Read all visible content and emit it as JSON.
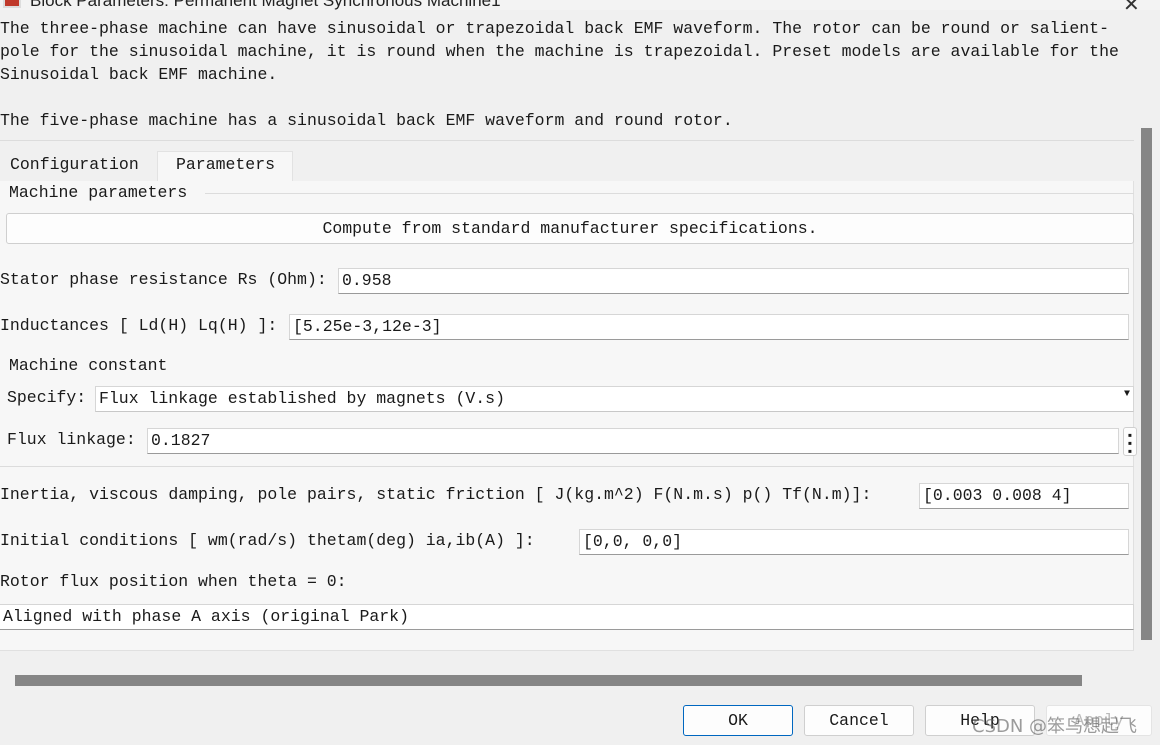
{
  "window": {
    "title": "Block Parameters: Permanent Magnet Synchronous Machine1"
  },
  "description": {
    "line1": "The three-phase machine can have sinusoidal or trapezoidal back EMF waveform. The rotor can be round or salient-",
    "line2": "pole for the sinusoidal machine, it is round when the machine is trapezoidal. Preset models are available for the",
    "line3": "Sinusoidal back EMF machine.",
    "line4": "The five-phase machine has a sinusoidal back EMF waveform and round rotor."
  },
  "tabs": [
    {
      "label": "Configuration",
      "active": false
    },
    {
      "label": "Parameters",
      "active": true
    }
  ],
  "machine_parameters": {
    "legend": "Machine parameters",
    "compute_button": "Compute from standard manufacturer specifications.",
    "stator_resistance": {
      "label": "Stator phase resistance Rs (Ohm):",
      "value": "0.958"
    },
    "inductances": {
      "label": "Inductances [ Ld(H) Lq(H) ]:",
      "value": "[5.25e-3,12e-3]"
    }
  },
  "machine_constant": {
    "legend": "Machine constant",
    "specify": {
      "label": "Specify:",
      "value": "Flux linkage established by magnets (V.s)"
    },
    "flux_linkage": {
      "label": "Flux linkage:",
      "value": "0.1827"
    }
  },
  "inertia": {
    "label": "Inertia, viscous damping, pole pairs, static friction [ J(kg.m^2)  F(N.m.s)  p()  Tf(N.m)]:",
    "value": "[0.003 0.008 4]"
  },
  "initial_conditions": {
    "label": "Initial conditions  [ wm(rad/s)  thetam(deg)  ia,ib(A) ]:",
    "value": "[0,0, 0,0]"
  },
  "rotor_flux": {
    "label": "Rotor flux position when theta = 0:",
    "value": "Aligned with phase A axis (original Park)"
  },
  "buttons": {
    "ok": "OK",
    "cancel": "Cancel",
    "help": "Help",
    "apply": "Apply"
  },
  "watermark": "CSDN @笨鸟想起飞"
}
